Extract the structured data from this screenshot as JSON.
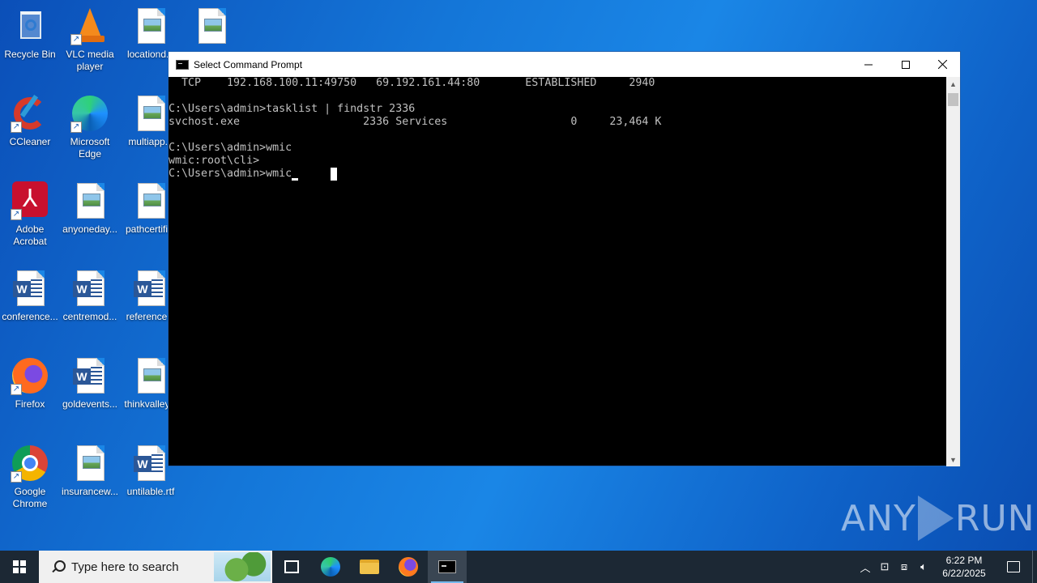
{
  "desktop": {
    "icons": [
      {
        "label": "Recycle Bin",
        "icon": "recycle-bin-icon"
      },
      {
        "label": "VLC media player",
        "icon": "vlc-icon"
      },
      {
        "label": "locationd...",
        "icon": "image-file-icon"
      },
      {
        "label": "",
        "icon": "image-file-icon"
      },
      {
        "label": "CCleaner",
        "icon": "ccleaner-icon"
      },
      {
        "label": "Microsoft Edge",
        "icon": "edge-icon"
      },
      {
        "label": "multiapp...",
        "icon": "image-file-icon"
      },
      {
        "label": "Adobe Acrobat",
        "icon": "acrobat-icon"
      },
      {
        "label": "anyoneday...",
        "icon": "image-file-icon"
      },
      {
        "label": "pathcertifi...",
        "icon": "image-file-icon"
      },
      {
        "label": "conference...",
        "icon": "word-doc-icon"
      },
      {
        "label": "centremod...",
        "icon": "word-doc-icon"
      },
      {
        "label": "reference...",
        "icon": "word-doc-icon"
      },
      {
        "label": "Firefox",
        "icon": "firefox-icon"
      },
      {
        "label": "goldevents...",
        "icon": "word-doc-icon"
      },
      {
        "label": "thinkvalley...",
        "icon": "image-file-icon"
      },
      {
        "label": "Google Chrome",
        "icon": "chrome-icon"
      },
      {
        "label": "insurancew...",
        "icon": "image-file-icon"
      },
      {
        "label": "untilable.rtf",
        "icon": "word-doc-icon"
      }
    ]
  },
  "window": {
    "title": "Select Command Prompt",
    "lines": [
      "  TCP    192.168.100.11:49750   69.192.161.44:80       ESTABLISHED     2940",
      "",
      "C:\\Users\\admin>tasklist | findstr 2336",
      "svchost.exe                   2336 Services                   0     23,464 K",
      "",
      "C:\\Users\\admin>wmic",
      "wmic:root\\cli>",
      "C:\\Users\\admin>wmic"
    ]
  },
  "watermark": {
    "left": "ANY",
    "right": "RUN"
  },
  "taskbar": {
    "search_placeholder": "Type here to search",
    "time": "6:22 PM",
    "date": "6/22/2025"
  }
}
